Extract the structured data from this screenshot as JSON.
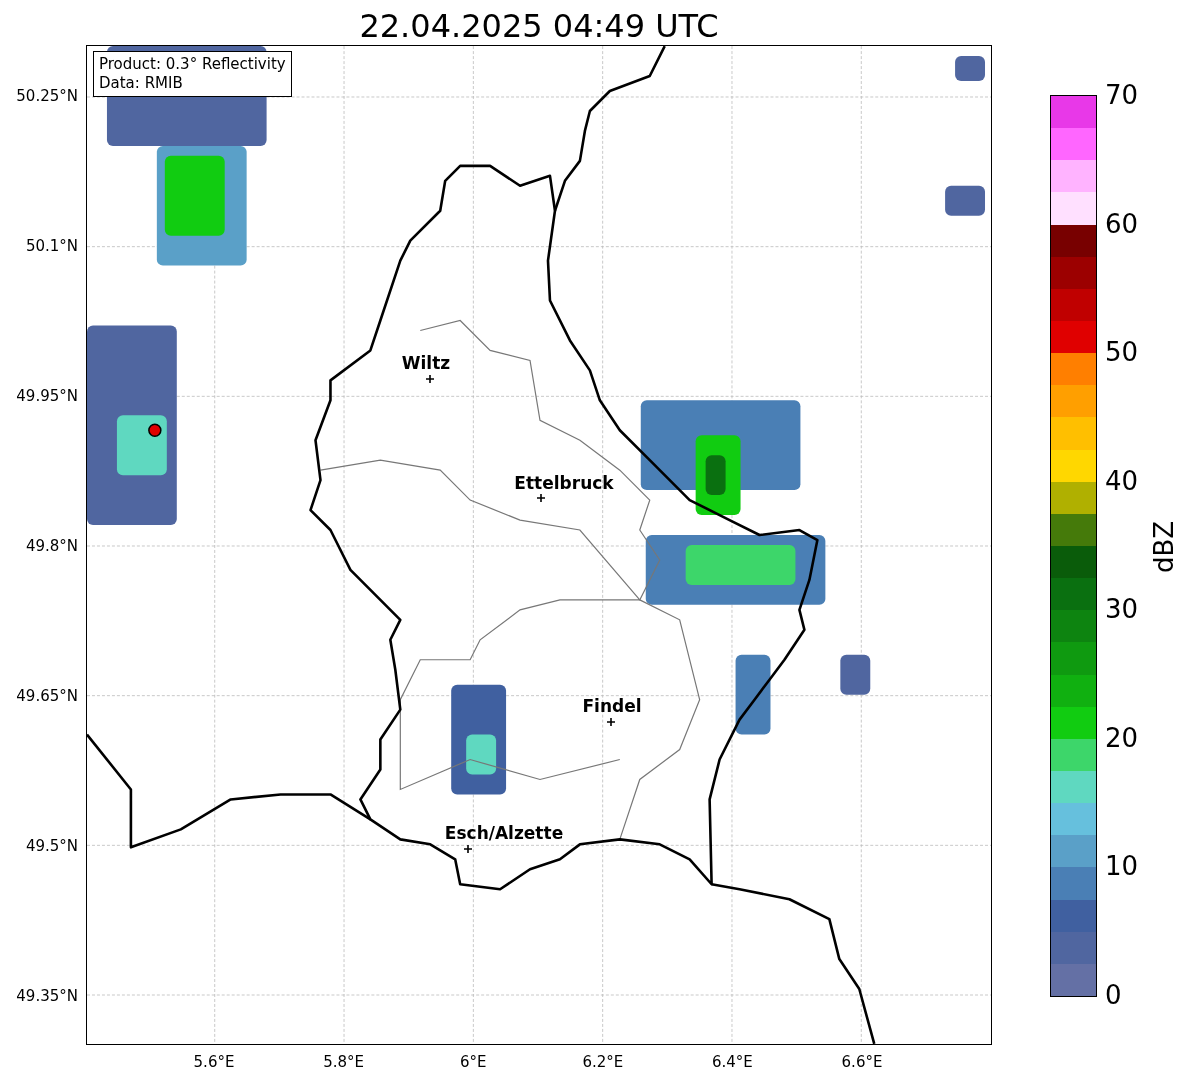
{
  "title": "22.04.2025 04:49 UTC",
  "info_box": [
    "Product: 0.3° Reflectivity",
    "Data: RMIB"
  ],
  "map": {
    "cities": [
      {
        "name": "Wiltz"
      },
      {
        "name": "Ettelbruck"
      },
      {
        "name": "Findel"
      },
      {
        "name": "Esch/Alzette"
      }
    ],
    "xticks": [
      "5.6°E",
      "5.8°E",
      "6°E",
      "6.2°E",
      "6.4°E",
      "6.6°E"
    ],
    "yticks": [
      "50.25°N",
      "50.1°N",
      "49.95°N",
      "49.8°N",
      "49.65°N",
      "49.5°N",
      "49.35°N"
    ]
  },
  "colorbar": {
    "label": "dBZ",
    "ticks": [
      "70",
      "60",
      "50",
      "40",
      "30",
      "20",
      "10",
      "0"
    ],
    "segments": [
      {
        "color": "#e838e8"
      },
      {
        "color": "#ff66ff"
      },
      {
        "color": "#ffb3ff"
      },
      {
        "color": "#ffe0ff"
      },
      {
        "color": "#780000"
      },
      {
        "color": "#9c0000"
      },
      {
        "color": "#c00000"
      },
      {
        "color": "#e00000"
      },
      {
        "color": "#ff7f00"
      },
      {
        "color": "#ff9f00"
      },
      {
        "color": "#ffbf00"
      },
      {
        "color": "#ffd700"
      },
      {
        "color": "#b0b000"
      },
      {
        "color": "#457a0a"
      },
      {
        "color": "#0a5c0a"
      },
      {
        "color": "#0a7010"
      },
      {
        "color": "#0d8410"
      },
      {
        "color": "#0f9a10"
      },
      {
        "color": "#10b010"
      },
      {
        "color": "#11cc11"
      },
      {
        "color": "#3dd66a"
      },
      {
        "color": "#5fd8c0"
      },
      {
        "color": "#66c0dd"
      },
      {
        "color": "#5aa0c8"
      },
      {
        "color": "#4a7fb5"
      },
      {
        "color": "#4060a0"
      },
      {
        "color": "#5066a0"
      },
      {
        "color": "#6470a5"
      }
    ]
  }
}
